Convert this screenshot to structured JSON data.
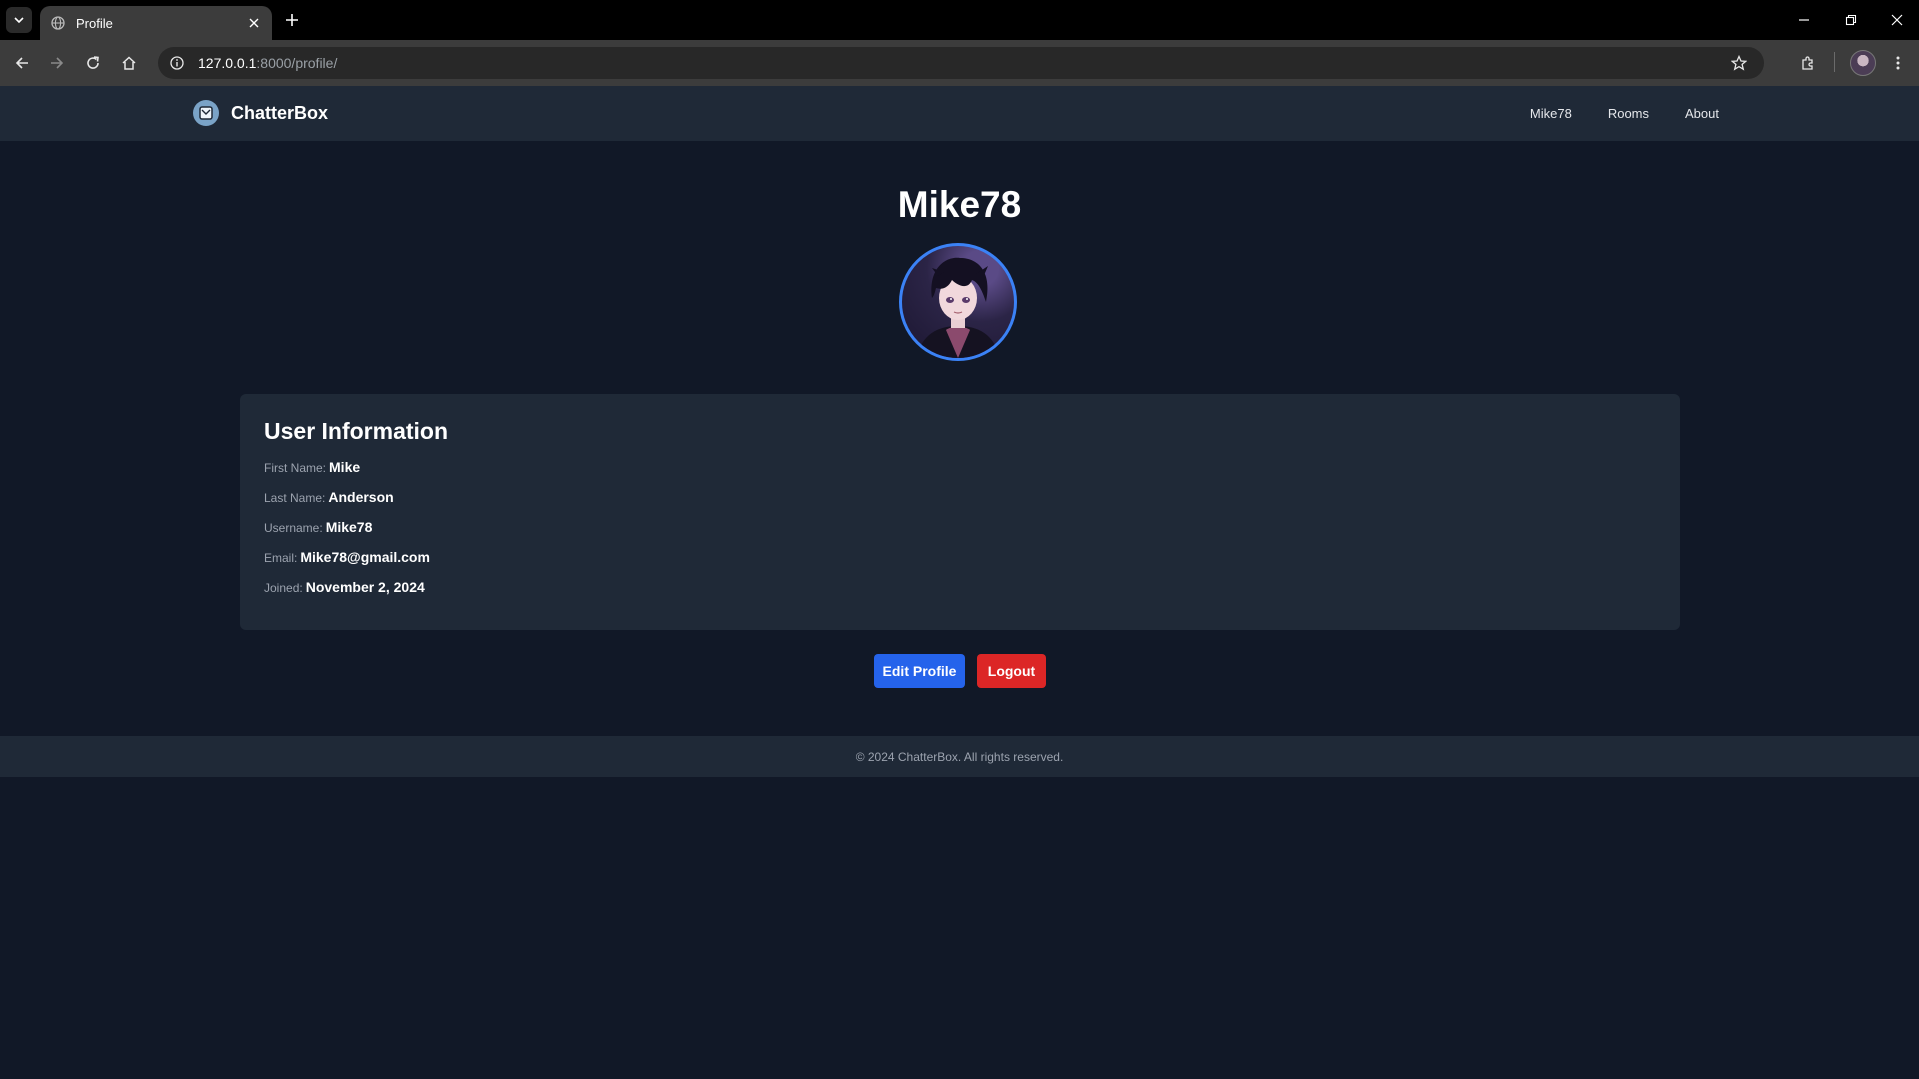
{
  "browser": {
    "tab_title": "Profile",
    "url_host": "127.0.0.1",
    "url_rest": ":8000/profile/"
  },
  "site": {
    "brand": "ChatterBox",
    "nav": [
      {
        "label": "Mike78"
      },
      {
        "label": "Rooms"
      },
      {
        "label": "About"
      }
    ]
  },
  "profile": {
    "username_title": "Mike78",
    "section_heading": "User Information",
    "fields": [
      {
        "label": "First Name:",
        "value": "Mike"
      },
      {
        "label": "Last Name:",
        "value": "Anderson"
      },
      {
        "label": "Username:",
        "value": "Mike78"
      },
      {
        "label": "Email:",
        "value": "Mike78@gmail.com"
      },
      {
        "label": "Joined:",
        "value": "November 2, 2024"
      }
    ],
    "edit_label": "Edit Profile",
    "logout_label": "Logout"
  },
  "footer": {
    "text": "© 2024 ChatterBox. All rights reserved."
  },
  "colors": {
    "page_bg": "#111827",
    "panel_bg": "#1f2937",
    "primary": "#2563eb",
    "danger": "#dc2626",
    "avatar_ring": "#3b82f6"
  },
  "icons": [
    "tab-list-icon",
    "globe-icon",
    "close-icon",
    "plus-icon",
    "minimize-icon",
    "restore-icon",
    "back-icon",
    "forward-icon",
    "reload-icon",
    "home-icon",
    "info-icon",
    "star-icon",
    "extensions-icon",
    "menu-icon",
    "mail-icon"
  ]
}
